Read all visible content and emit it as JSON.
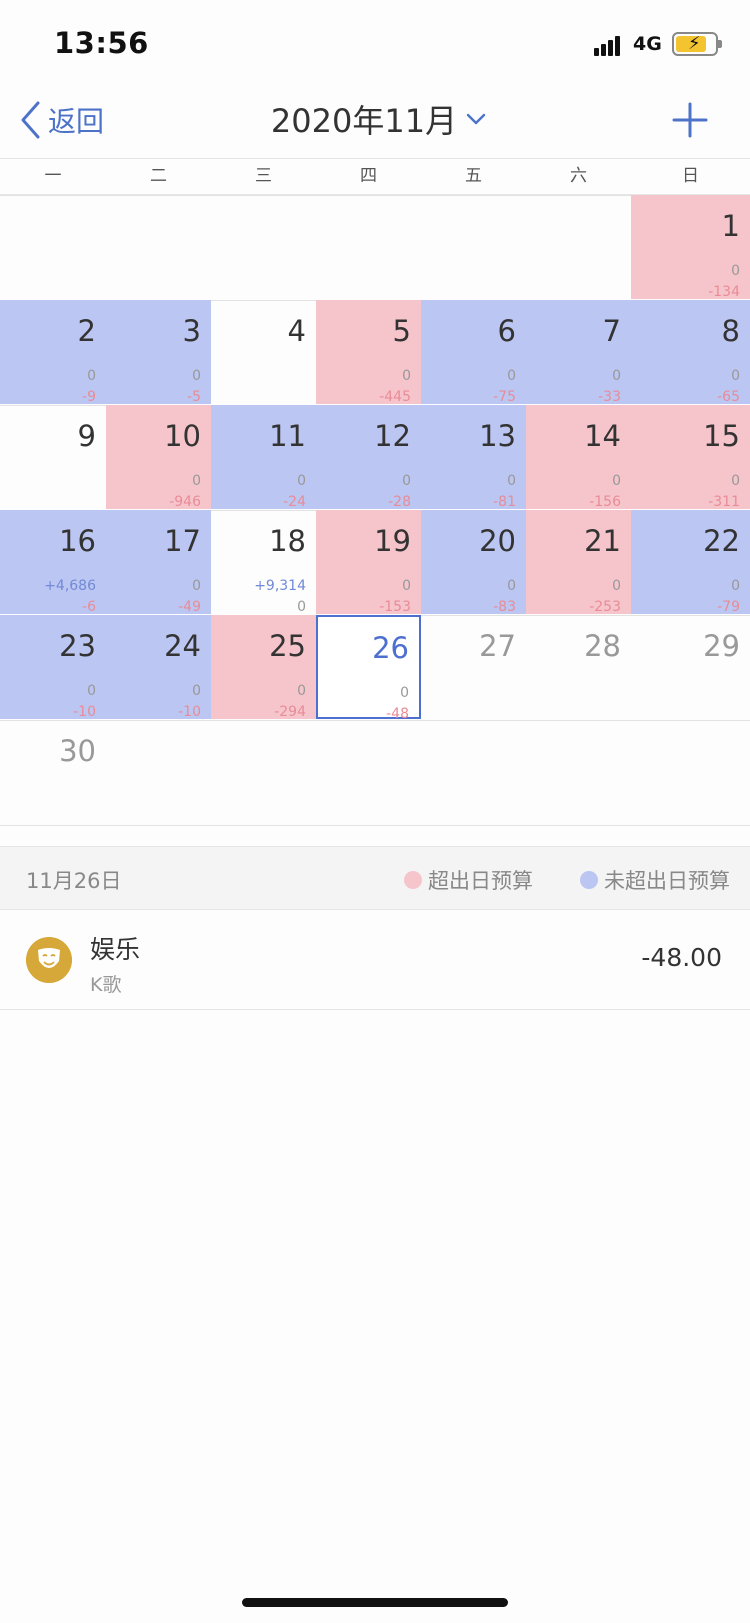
{
  "status_bar": {
    "time": "13:56",
    "network": "4G"
  },
  "nav": {
    "back_label": "返回",
    "month_title": "2020年11月"
  },
  "weekdays": [
    "一",
    "二",
    "三",
    "四",
    "五",
    "六",
    "日"
  ],
  "calendar": {
    "weeks": [
      [
        null,
        null,
        null,
        null,
        null,
        null,
        {
          "day": "1",
          "income": "0",
          "expense": "-134",
          "status": "over"
        }
      ],
      [
        {
          "day": "2",
          "income": "0",
          "expense": "-9",
          "status": "under"
        },
        {
          "day": "3",
          "income": "0",
          "expense": "-5",
          "status": "under"
        },
        {
          "day": "4",
          "income": "",
          "expense": "",
          "status": "none"
        },
        {
          "day": "5",
          "income": "0",
          "expense": "-445",
          "status": "over"
        },
        {
          "day": "6",
          "income": "0",
          "expense": "-75",
          "status": "under"
        },
        {
          "day": "7",
          "income": "0",
          "expense": "-33",
          "status": "under"
        },
        {
          "day": "8",
          "income": "0",
          "expense": "-65",
          "status": "under"
        }
      ],
      [
        {
          "day": "9",
          "income": "",
          "expense": "",
          "status": "none"
        },
        {
          "day": "10",
          "income": "0",
          "expense": "-946",
          "status": "over"
        },
        {
          "day": "11",
          "income": "0",
          "expense": "-24",
          "status": "under"
        },
        {
          "day": "12",
          "income": "0",
          "expense": "-28",
          "status": "under"
        },
        {
          "day": "13",
          "income": "0",
          "expense": "-81",
          "status": "under"
        },
        {
          "day": "14",
          "income": "0",
          "expense": "-156",
          "status": "over"
        },
        {
          "day": "15",
          "income": "0",
          "expense": "-311",
          "status": "over"
        }
      ],
      [
        {
          "day": "16",
          "income": "+4,686",
          "expense": "-6",
          "status": "under"
        },
        {
          "day": "17",
          "income": "0",
          "expense": "-49",
          "status": "under"
        },
        {
          "day": "18",
          "income": "+9,314",
          "expense": "0",
          "status": "none"
        },
        {
          "day": "19",
          "income": "0",
          "expense": "-153",
          "status": "over"
        },
        {
          "day": "20",
          "income": "0",
          "expense": "-83",
          "status": "under"
        },
        {
          "day": "21",
          "income": "0",
          "expense": "-253",
          "status": "over"
        },
        {
          "day": "22",
          "income": "0",
          "expense": "-79",
          "status": "under"
        }
      ],
      [
        {
          "day": "23",
          "income": "0",
          "expense": "-10",
          "status": "under"
        },
        {
          "day": "24",
          "income": "0",
          "expense": "-10",
          "status": "under"
        },
        {
          "day": "25",
          "income": "0",
          "expense": "-294",
          "status": "over"
        },
        {
          "day": "26",
          "income": "0",
          "expense": "-48",
          "status": "selected"
        },
        {
          "day": "27",
          "income": "",
          "expense": "",
          "status": "future"
        },
        {
          "day": "28",
          "income": "",
          "expense": "",
          "status": "future"
        },
        {
          "day": "29",
          "income": "",
          "expense": "",
          "status": "future"
        }
      ],
      [
        {
          "day": "30",
          "income": "",
          "expense": "",
          "status": "future"
        },
        null,
        null,
        null,
        null,
        null,
        null
      ]
    ]
  },
  "legend": {
    "selected_date": "11月26日",
    "over_label": "超出日预算",
    "under_label": "未超出日预算",
    "over_color": "#f6c5cb",
    "under_color": "#bcc6f3"
  },
  "transactions": [
    {
      "category": "娱乐",
      "note": "K歌",
      "amount": "-48.00",
      "icon": "smile-mask-icon"
    }
  ]
}
